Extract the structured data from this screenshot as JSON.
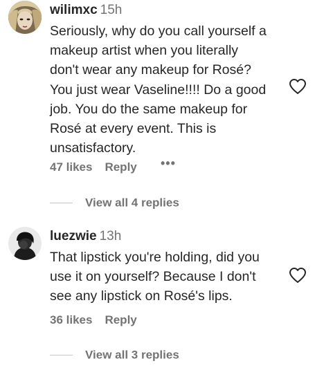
{
  "comments": [
    {
      "username": "wilimxc",
      "time": "15h",
      "text": "Seriously, why do you call yourself a\nmakeup artist when you literally\ndon't wear any makeup for Rosé?\nYou just wear Vaseline!!!! Do a good\njob. You do the same makeup for\nRosé at every event. This is\nunsatisfactory.",
      "likes": "47 likes",
      "reply_label": "Reply",
      "more_label": "•••",
      "view_replies": "View all 4 replies"
    },
    {
      "username": "luezwie",
      "time": "13h",
      "text": "That lipstick you're holding, did you\nuse it on yourself? Because I don't\nsee any lipstick on Rosé's lips.",
      "likes": "36 likes",
      "reply_label": "Reply",
      "view_replies": "View all 3 replies"
    }
  ],
  "icons": {
    "like": "heart-outline-icon",
    "more": "more-options-icon"
  },
  "colors": {
    "text": "#262626",
    "secondary": "#737373",
    "divider": "#c7c7c7"
  }
}
